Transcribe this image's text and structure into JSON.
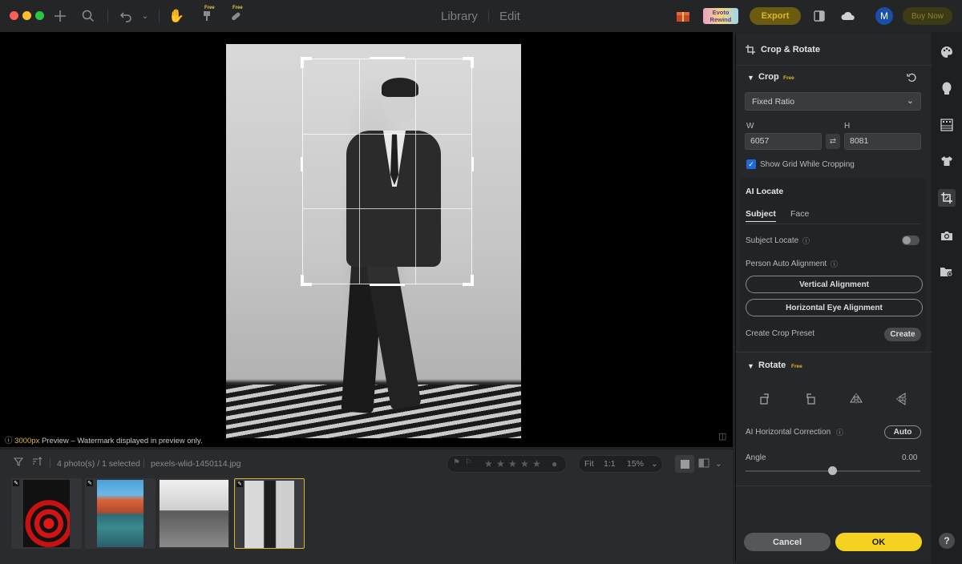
{
  "titlebar": {
    "free_tag_1": "Free",
    "free_tag_2": "Free",
    "tab_library": "Library",
    "tab_edit": "Edit",
    "export_label": "Export",
    "evoto_rewind": "Evoto Rewind",
    "avatar_initial": "M",
    "buy_now_label": "Buy Now",
    "colors": {
      "export_bg": "#6b5b10",
      "export_text": "#d9b82a",
      "avatar_bg": "#1b4ea8"
    }
  },
  "canvas": {
    "preview_size": "3000px",
    "preview_note": " Preview – Watermark displayed in preview only."
  },
  "filmstrip": {
    "count_text": "4 photo(s) / 1 selected",
    "filename": "pexels-wlid-1450114.jpg",
    "fit_label": "Fit",
    "one_to_one_label": "1:1",
    "zoom_value": "15%",
    "thumbnails": [
      {
        "name": "spiral",
        "selected": false
      },
      {
        "name": "building-reflection",
        "selected": false
      },
      {
        "name": "stairs",
        "selected": false
      },
      {
        "name": "man-in-suit",
        "selected": true
      }
    ]
  },
  "panel": {
    "title": "Crop & Rotate",
    "crop": {
      "section_label": "Crop",
      "free_tag": "Free",
      "ratio_value": "Fixed Ratio",
      "w_label": "W",
      "h_label": "H",
      "w_value": "6057",
      "h_value": "8081",
      "show_grid_label": "Show Grid While Cropping",
      "show_grid_checked": true
    },
    "ai_locate": {
      "title": "AI Locate",
      "tab_subject": "Subject",
      "tab_face": "Face",
      "subject_locate_label": "Subject Locate",
      "person_auto_alignment_label": "Person Auto Alignment",
      "vertical_alignment_label": "Vertical Alignment",
      "horizontal_eye_alignment_label": "Horizontal Eye Alignment"
    },
    "crop_preset_label": "Create Crop Preset",
    "create_label": "Create",
    "rotate": {
      "section_label": "Rotate",
      "free_tag": "Free",
      "ai_horizontal_correction_label": "AI Horizontal Correction",
      "auto_label": "Auto",
      "angle_label": "Angle",
      "angle_value": "0.00"
    },
    "cancel_label": "Cancel",
    "ok_label": "OK",
    "colors": {
      "ok_bg": "#f4d21f",
      "checkbox": "#1f6ad8"
    }
  },
  "rail": {
    "help_label": "?"
  }
}
